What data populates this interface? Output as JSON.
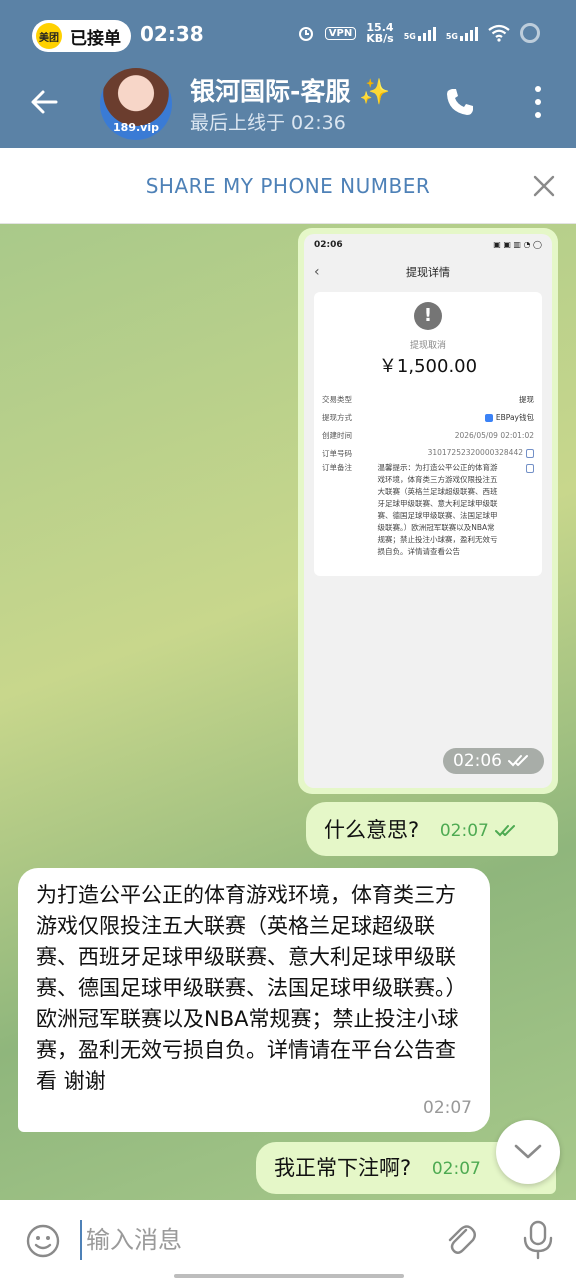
{
  "status_bar": {
    "app_pill_icon": "美团",
    "app_pill_label": "已接单",
    "time": "02:38",
    "vpn": "VPN",
    "speed_top": "15.4",
    "speed_bottom": "KB/s",
    "net1": "5G",
    "net2": "5G"
  },
  "header": {
    "title": "银河国际-客服 ✨",
    "subtitle": "最后上线于 02:36",
    "avatar_text": "189.vip"
  },
  "share_bar": {
    "label": "SHARE MY PHONE NUMBER"
  },
  "messages": {
    "image": {
      "inner_status_time": "02:06",
      "inner_status_icons": "▣ ▣ ▥ ◔ ◯",
      "inner_title": "提现详情",
      "status_label": "提现取消",
      "amount": "￥1,500.00",
      "rows": [
        {
          "label": "交易类型",
          "value": "提现"
        },
        {
          "label": "提现方式",
          "value": "EBPay钱包"
        },
        {
          "label": "创建时间",
          "value": "2026/05/09 02:01:02"
        },
        {
          "label": "订单号码",
          "value": "31017252320000328442"
        }
      ],
      "note_label": "订单备注",
      "note_value": "温馨提示：为打造公平公正的体育游戏环境，体育类三方游戏仅限投注五大联赛（英格兰足球超级联赛、西班牙足球甲级联赛、意大利足球甲级联赛、德国足球甲级联赛、法国足球甲级联赛。）欧洲冠军联赛以及NBA常规赛；禁止投注小球赛，盈利无效亏损自负。详情请查看公告",
      "time": "02:06"
    },
    "out1": {
      "text": "什么意思?",
      "time": "02:07"
    },
    "in1": {
      "text": "为打造公平公正的体育游戏环境，体育类三方游戏仅限投注五大联赛（英格兰足球超级联赛、西班牙足球甲级联赛、意大利足球甲级联赛、德国足球甲级联赛、法国足球甲级联赛。）欧洲冠军联赛以及NBA常规赛；禁止投注小球赛，盈利无效亏损自负。详情请在平台公告查看 谢谢",
      "time": "02:07"
    },
    "out2": {
      "text": "我正常下注啊?",
      "time": "02:07"
    }
  },
  "input": {
    "placeholder": "输入消息"
  },
  "colors": {
    "header": "#5b82a6",
    "outgoing_bubble": "#e5f7c8",
    "accent": "#4e81b7",
    "read_check": "#4eaa52"
  }
}
